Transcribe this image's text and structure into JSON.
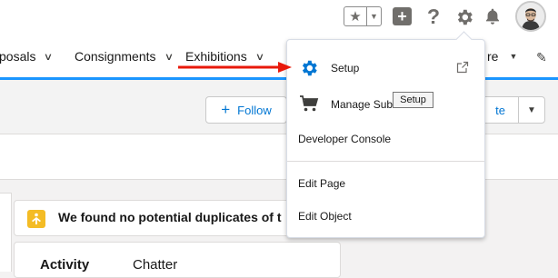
{
  "global_header": {
    "favorites_star_icon": "star-icon",
    "favorites_caret_icon": "caret-down-icon",
    "icons": [
      "plus-icon",
      "help-icon",
      "gear-icon",
      "bell-icon"
    ],
    "help_glyph": "?",
    "plus_glyph": "+"
  },
  "nav": {
    "items": [
      {
        "label": "posals"
      },
      {
        "label": "Consignments"
      },
      {
        "label": "Exhibitions"
      },
      {
        "label": "re"
      }
    ],
    "active_color": "#1b96ff"
  },
  "record_header": {
    "follow_label": "Follow",
    "button_group_label": "te"
  },
  "main": {
    "duplicates_text": "We found no potential duplicates of t",
    "duplicates_icon": "duplicate-icon",
    "tabs": [
      {
        "label": "Activity"
      },
      {
        "label": "Chatter"
      }
    ]
  },
  "setup_menu": {
    "items": [
      {
        "label": "Setup",
        "icon": "gear-icon"
      },
      {
        "label": "Manage Subs",
        "icon": "cart-icon"
      },
      {
        "label": "Developer Console"
      },
      {
        "label": "Edit Page"
      },
      {
        "label": "Edit Object"
      }
    ],
    "tooltip": "Setup",
    "accent_color": "#0176d3"
  },
  "annotation": {
    "arrow_color": "#e8190b"
  }
}
